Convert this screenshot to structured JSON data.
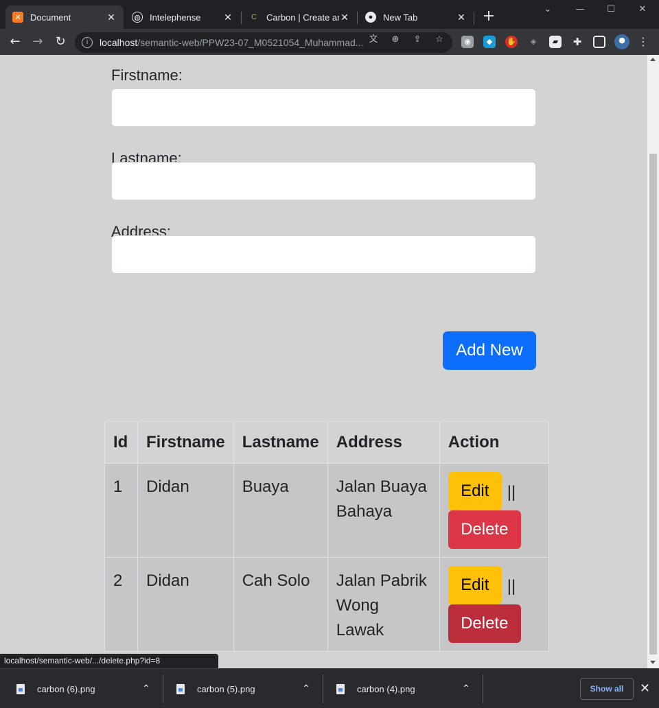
{
  "browser": {
    "tabs": [
      {
        "title": "Document",
        "favicon": "xampp-icon",
        "active": true
      },
      {
        "title": "Intelephense",
        "favicon": "globe-icon",
        "active": false
      },
      {
        "title": "Carbon | Create and",
        "favicon": "carbon-icon",
        "active": false
      },
      {
        "title": "New Tab",
        "favicon": "chrome-icon",
        "active": false
      }
    ],
    "url_host": "localhost",
    "url_path": "/semantic-web/PPW23-07_M0521054_Muhammad...",
    "status_url": "localhost/semantic-web/.../delete.php?id=8"
  },
  "form": {
    "firstname_label": "Firstname:",
    "lastname_label": "Lastname:",
    "address_label": "Address:",
    "firstname_value": "",
    "lastname_value": "",
    "address_value": "",
    "add_button": "Add New"
  },
  "table": {
    "headers": [
      "Id",
      "Firstname",
      "Lastname",
      "Address",
      "Action"
    ],
    "rows": [
      {
        "id": "1",
        "firstname": "Didan",
        "lastname": "Buaya",
        "address": "Jalan Buaya Bahaya",
        "edit": "Edit",
        "separator": "||",
        "delete": "Delete"
      },
      {
        "id": "2",
        "firstname": "Didan",
        "lastname": "Cah Solo",
        "address": "Jalan Pabrik Wong Lawak",
        "edit": "Edit",
        "separator": "||",
        "delete": "Delete"
      }
    ]
  },
  "downloads": {
    "items": [
      "carbon (6).png",
      "carbon (5).png",
      "carbon (4).png"
    ],
    "show_all": "Show all"
  },
  "colors": {
    "primary": "#0d6efd",
    "warning": "#ffc107",
    "danger": "#dc3545",
    "page_bg": "#d3d3d3"
  }
}
